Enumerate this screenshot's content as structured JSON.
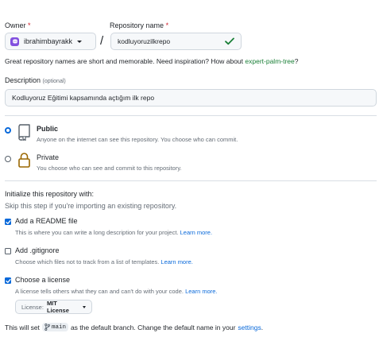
{
  "owner": {
    "label": "Owner",
    "required_mark": "*",
    "value": "ibrahimbayrakk"
  },
  "separator": "/",
  "repo_name": {
    "label": "Repository name",
    "required_mark": "*",
    "value": "kodluyoruzilkrepo"
  },
  "name_hint": {
    "text": "Great repository names are short and memorable. Need inspiration? How about",
    "suggestion": "expert-palm-tree",
    "end": "?"
  },
  "description": {
    "label": "Description",
    "optional": "(optional)",
    "value": "Kodluyoruz Eğitimi kapsamında açtığım ilk repo"
  },
  "visibility": {
    "public": {
      "title": "Public",
      "desc": "Anyone on the internet can see this repository. You choose who can commit.",
      "selected": true
    },
    "private": {
      "title": "Private",
      "desc": "You choose who can see and commit to this repository.",
      "selected": false
    }
  },
  "init": {
    "heading": "Initialize this repository with:",
    "subheading": "Skip this step if you're importing an existing repository.",
    "readme": {
      "label": "Add a README file",
      "desc": "This is where you can write a long description for your project.",
      "link": "Learn more.",
      "checked": true
    },
    "gitignore": {
      "label": "Add .gitignore",
      "desc": "Choose which files not to track from a list of templates.",
      "link": "Learn more.",
      "checked": false
    },
    "license": {
      "label": "Choose a license",
      "desc": "A license tells others what they can and can't do with your code.",
      "link": "Learn more.",
      "checked": true
    }
  },
  "license_select": {
    "prefix": "License:",
    "value": "MIT License"
  },
  "branch_note": {
    "before": "This will set",
    "branch": "main",
    "middle": "as the default branch. Change the default name in your",
    "link": "settings",
    "end": "."
  },
  "colors": {
    "accent": "#0969da",
    "success": "#1a7f37",
    "required": "#cf222e",
    "avatar": "#8250df"
  },
  "icons": {
    "owner_avatar": "octocat-avatar",
    "valid": "check-icon",
    "public": "repo-icon",
    "private": "lock-icon",
    "branch": "git-branch-icon"
  }
}
